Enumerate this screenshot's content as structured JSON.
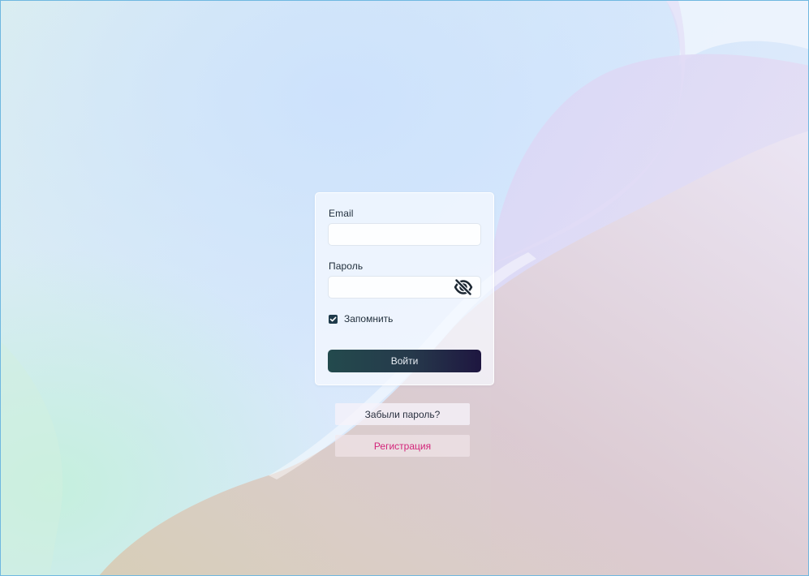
{
  "login_form": {
    "email": {
      "label": "Email",
      "value": "",
      "placeholder": ""
    },
    "password": {
      "label": "Пароль",
      "value": "",
      "placeholder": "",
      "toggle_icon": "eye-slash-icon"
    },
    "remember": {
      "label": "Запомнить",
      "checked": true
    },
    "submit_label": "Войти"
  },
  "links": {
    "forgot_password": "Забыли пароль?",
    "register": "Регистрация"
  },
  "colors": {
    "primary_button_start": "#234a4d",
    "primary_button_end": "#1e1640",
    "register_link": "#d3257a",
    "checkbox": "#1e3a4a",
    "frame_border": "#6fb8e0"
  }
}
